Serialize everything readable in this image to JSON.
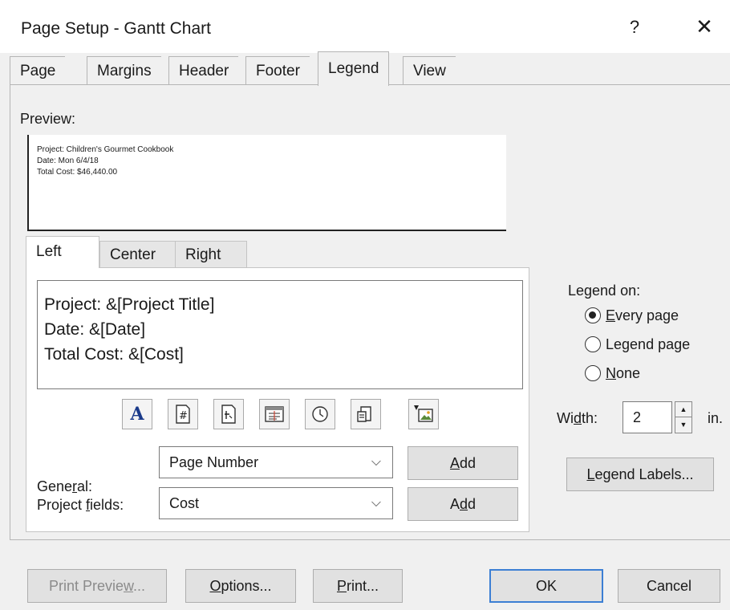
{
  "window": {
    "title": "Page Setup - Gantt Chart",
    "help": "?",
    "close": "✕"
  },
  "tabs": [
    "Page",
    "Margins",
    "Header",
    "Footer",
    "Legend",
    "View"
  ],
  "active_tab": "Legend",
  "preview": {
    "label": "Preview:",
    "lines": [
      "Project: Children's Gourmet Cookbook",
      "Date: Mon 6/4/18",
      "Total Cost: $46,440.00"
    ]
  },
  "alignment_tabs": [
    "Left",
    "Center",
    "Right"
  ],
  "active_alignment_tab": "Left",
  "legend_text": [
    "Project: &[Project Title]",
    "Date: &[Date]",
    "Total Cost: &[Cost]"
  ],
  "insert_buttons": [
    {
      "icon": "font-icon",
      "glyph": "A"
    },
    {
      "icon": "page-number-icon",
      "glyph": "#"
    },
    {
      "icon": "total-pages-icon",
      "glyph": "+"
    },
    {
      "icon": "date-icon",
      "glyph": "date"
    },
    {
      "icon": "time-icon",
      "glyph": "time"
    },
    {
      "icon": "file-name-icon",
      "glyph": "file"
    },
    {
      "icon": "picture-icon",
      "glyph": "pic"
    }
  ],
  "general": {
    "label_pre": "Gene",
    "label_u": "r",
    "label_post": "al:",
    "value": "Page Number",
    "add_pre": "",
    "add_u": "A",
    "add_post": "dd"
  },
  "project_fields": {
    "label_pre": "Project ",
    "label_u": "f",
    "label_post": "ields:",
    "value": "Cost",
    "add_pre": "A",
    "add_u": "d",
    "add_post": "d"
  },
  "legend_on": {
    "label": "Legend on:",
    "options": [
      {
        "pre": "",
        "u": "E",
        "post": "very page",
        "selected": true
      },
      {
        "pre": "Le",
        "u": "g",
        "post": "end page",
        "selected": false
      },
      {
        "pre": "",
        "u": "N",
        "post": "one",
        "selected": false
      }
    ]
  },
  "width": {
    "label_pre": "Wi",
    "label_u": "d",
    "label_post": "th:",
    "value": "2",
    "unit": "in."
  },
  "legend_labels_button": {
    "pre": "",
    "u": "L",
    "post": "egend Labels..."
  },
  "footer_buttons": {
    "print_preview": {
      "pre": "Print Previe",
      "u": "w",
      "post": "..."
    },
    "options": {
      "pre": "",
      "u": "O",
      "post": "ptions..."
    },
    "print": {
      "pre": "",
      "u": "P",
      "post": "rint..."
    },
    "ok": "OK",
    "cancel": "Cancel"
  },
  "colors": {
    "accent": "#3c7fd4",
    "dialog_bg": "#f0f0f0"
  }
}
